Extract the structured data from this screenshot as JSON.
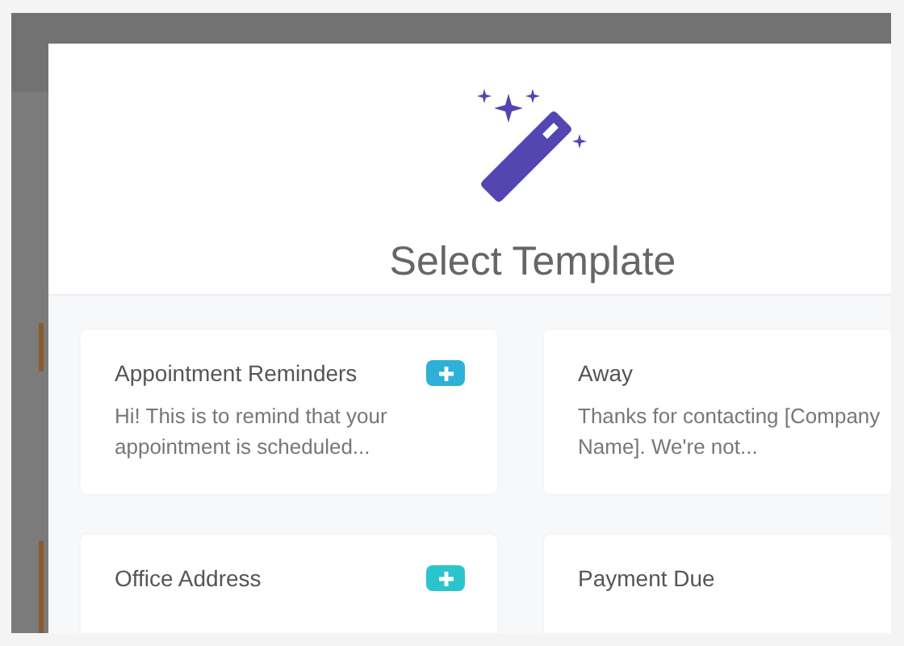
{
  "dialog": {
    "title": "Select Template"
  },
  "templates": [
    {
      "name": "Appointment Reminders",
      "preview": "Hi! This is to remind that your appointment is scheduled...",
      "color": "#2fb0d9"
    },
    {
      "name": "Away",
      "preview": "Thanks for contacting [Company Name]. We're not..."
    },
    {
      "name": "Office Address",
      "color": "#2cc4cc"
    },
    {
      "name": "Payment Due"
    }
  ]
}
